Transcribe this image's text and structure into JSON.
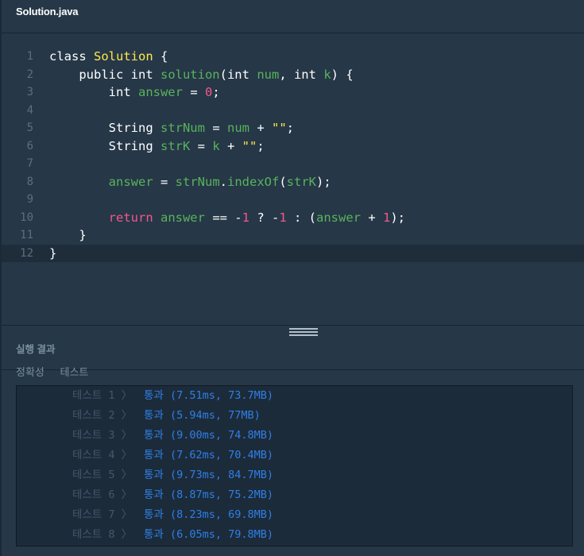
{
  "file_tab": {
    "label": "Solution.java"
  },
  "editor": {
    "lines": [
      {
        "no": "1",
        "tokens": [
          [
            "kw",
            "class "
          ],
          [
            "cls",
            "Solution"
          ],
          [
            "kw",
            " {"
          ]
        ]
      },
      {
        "no": "2",
        "tokens": [
          [
            "kw",
            "    public int "
          ],
          [
            "fn",
            "solution"
          ],
          [
            "kw",
            "(int "
          ],
          [
            "var",
            "num"
          ],
          [
            "kw",
            ", int "
          ],
          [
            "var",
            "k"
          ],
          [
            "kw",
            ") {"
          ]
        ]
      },
      {
        "no": "3",
        "tokens": [
          [
            "kw",
            "        int "
          ],
          [
            "var",
            "answer"
          ],
          [
            "kw",
            " = "
          ],
          [
            "num",
            "0"
          ],
          [
            "kw",
            ";"
          ]
        ]
      },
      {
        "no": "4",
        "tokens": []
      },
      {
        "no": "5",
        "tokens": [
          [
            "kw",
            "        String "
          ],
          [
            "var",
            "strNum"
          ],
          [
            "kw",
            " = "
          ],
          [
            "var",
            "num"
          ],
          [
            "kw",
            " + "
          ],
          [
            "str",
            "\"\""
          ],
          [
            "kw",
            ";"
          ]
        ]
      },
      {
        "no": "6",
        "tokens": [
          [
            "kw",
            "        String "
          ],
          [
            "var",
            "strK"
          ],
          [
            "kw",
            " = "
          ],
          [
            "var",
            "k"
          ],
          [
            "kw",
            " + "
          ],
          [
            "str",
            "\"\""
          ],
          [
            "kw",
            ";"
          ]
        ]
      },
      {
        "no": "7",
        "tokens": []
      },
      {
        "no": "8",
        "tokens": [
          [
            "var",
            "        answer"
          ],
          [
            "kw",
            " = "
          ],
          [
            "var",
            "strNum"
          ],
          [
            "kw",
            "."
          ],
          [
            "fn",
            "indexOf"
          ],
          [
            "kw",
            "("
          ],
          [
            "var",
            "strK"
          ],
          [
            "kw",
            ");"
          ]
        ]
      },
      {
        "no": "9",
        "tokens": []
      },
      {
        "no": "10",
        "tokens": [
          [
            "ret",
            "        return "
          ],
          [
            "var",
            "answer"
          ],
          [
            "kw",
            " == -"
          ],
          [
            "num",
            "1"
          ],
          [
            "kw",
            " ? -"
          ],
          [
            "num",
            "1"
          ],
          [
            "kw",
            " : ("
          ],
          [
            "var",
            "answer"
          ],
          [
            "kw",
            " + "
          ],
          [
            "num",
            "1"
          ],
          [
            "kw",
            ");"
          ]
        ]
      },
      {
        "no": "11",
        "tokens": [
          [
            "kw",
            "    }"
          ]
        ]
      },
      {
        "no": "12",
        "tokens": [
          [
            "kw",
            "}"
          ]
        ],
        "active": true
      }
    ]
  },
  "results": {
    "title": "실행 결과",
    "tabs": [
      "정확성",
      "테스트"
    ],
    "rows": [
      {
        "name": "테스트 1 〉",
        "value": "통과 (7.51ms, 73.7MB)"
      },
      {
        "name": "테스트 2 〉",
        "value": "통과 (5.94ms, 77MB)"
      },
      {
        "name": "테스트 3 〉",
        "value": "통과 (9.00ms, 74.8MB)"
      },
      {
        "name": "테스트 4 〉",
        "value": "통과 (7.62ms, 70.4MB)"
      },
      {
        "name": "테스트 5 〉",
        "value": "통과 (9.73ms, 84.7MB)"
      },
      {
        "name": "테스트 6 〉",
        "value": "통과 (8.87ms, 75.2MB)"
      },
      {
        "name": "테스트 7 〉",
        "value": "통과 (8.23ms, 69.8MB)"
      },
      {
        "name": "테스트 8 〉",
        "value": "통과 (6.05ms, 79.8MB)"
      }
    ]
  },
  "colors": {
    "background": "#263747",
    "keyword": "#ffffff",
    "class_name": "#ffe84d",
    "identifier": "#59b35c",
    "number": "#f0588e",
    "pass": "#2f7fe6"
  }
}
